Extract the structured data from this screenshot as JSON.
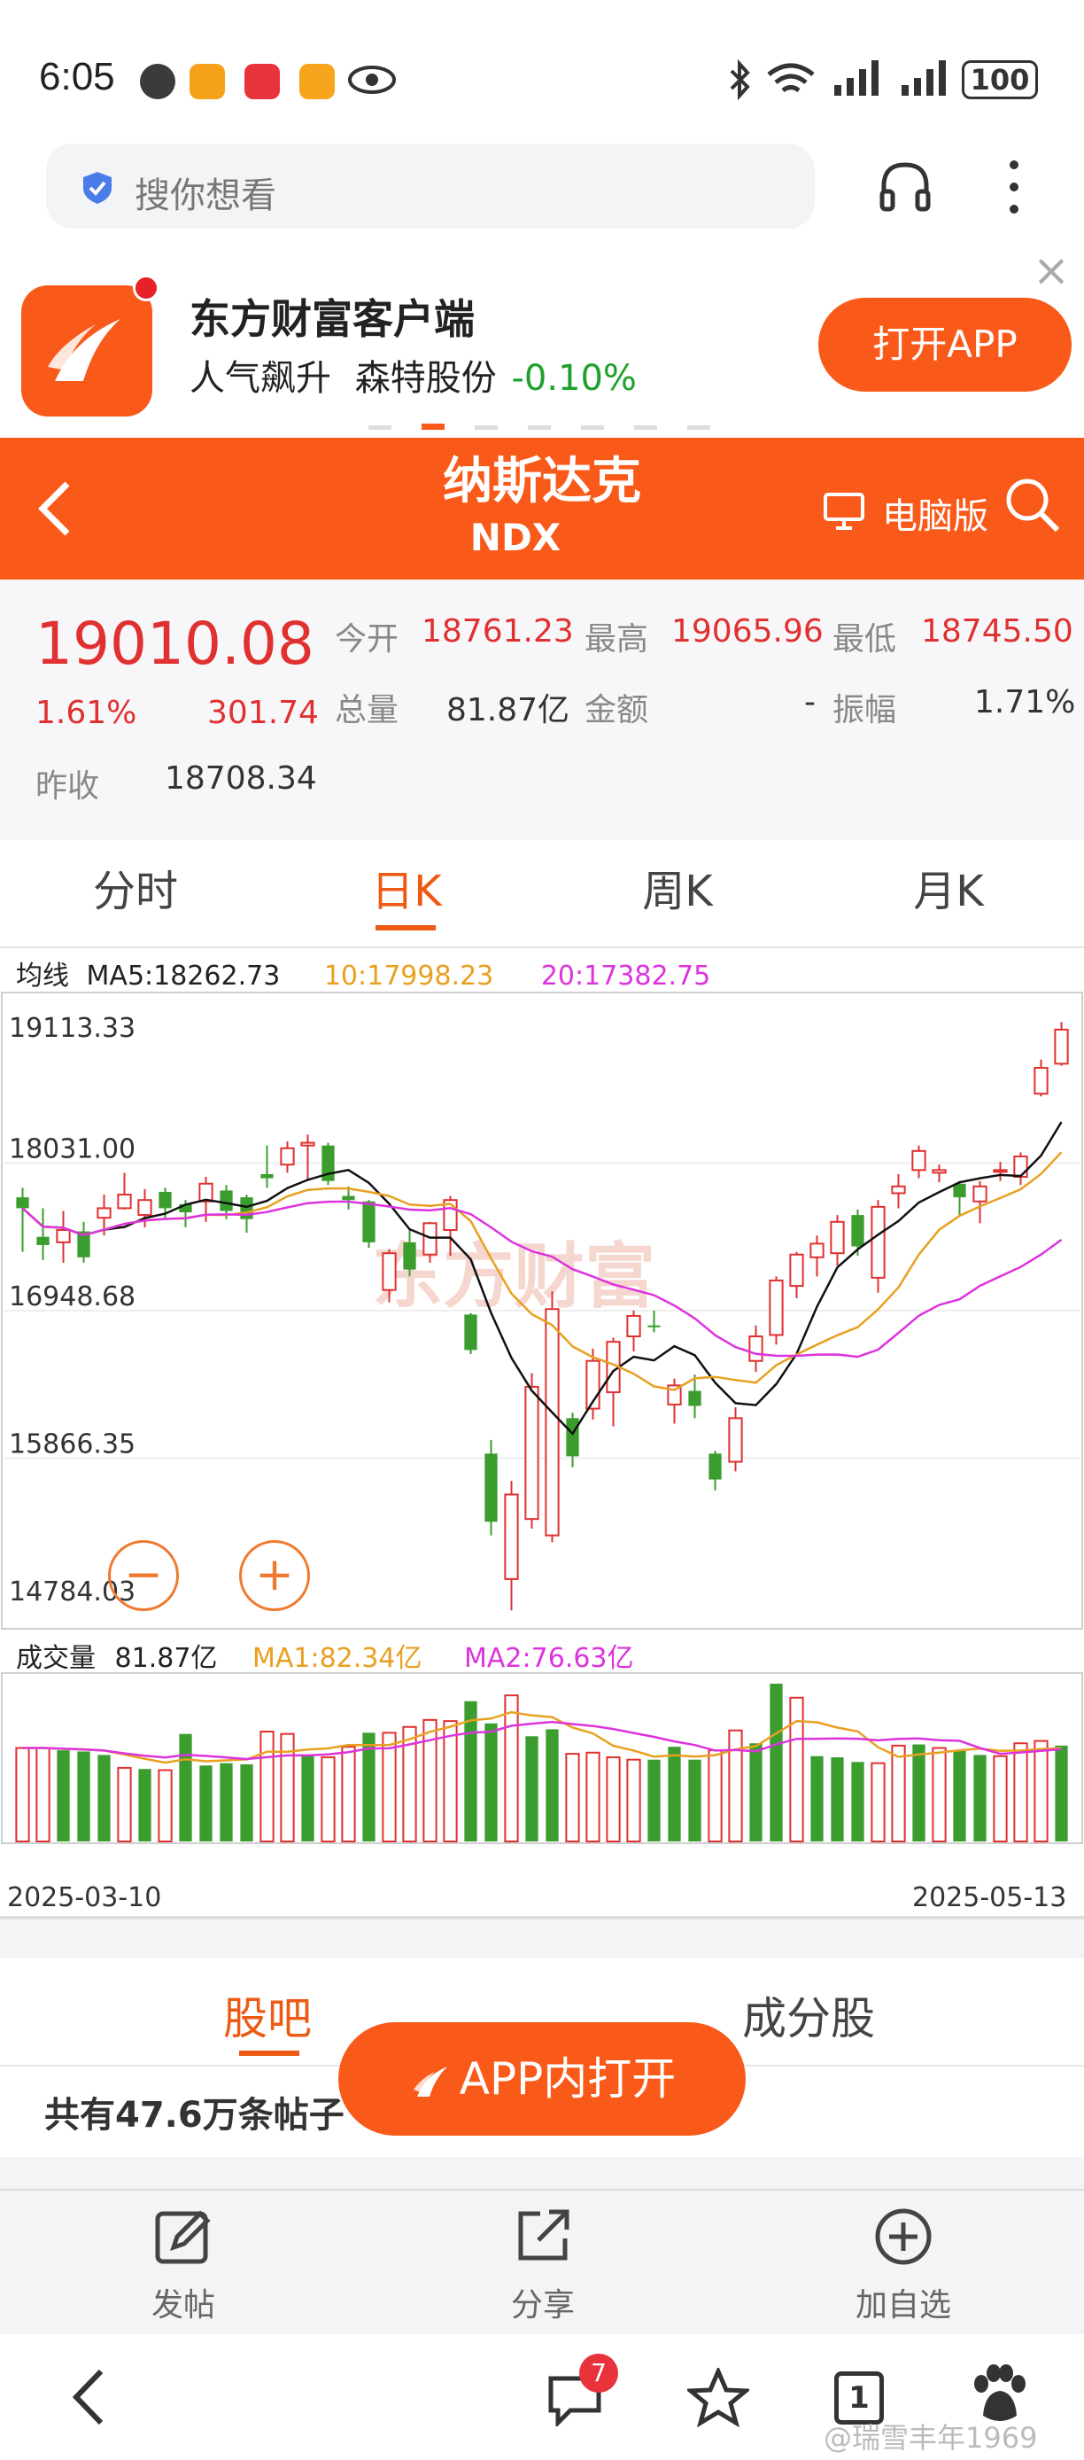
{
  "status_bar": {
    "time": "6:05",
    "battery": "100"
  },
  "search": {
    "placeholder": "搜你想看"
  },
  "ad_banner": {
    "title": "东方财富客户端",
    "subtitle_prefix": "人气飙升",
    "stock_name": "森特股份",
    "stock_change": "-0.10%",
    "button": "打开APP",
    "close": "×"
  },
  "header": {
    "title": "纳斯达克",
    "code": "NDX",
    "desktop_label": "电脑版"
  },
  "quote": {
    "price": "19010.08",
    "change_pct": "1.61%",
    "change_abs": "301.74",
    "prev_close_label": "昨收",
    "prev_close": "18708.34",
    "open_label": "今开",
    "open": "18761.23",
    "high_label": "最高",
    "high": "19065.96",
    "low_label": "最低",
    "low": "18745.50",
    "volume_label": "总量",
    "volume": "81.87亿",
    "amount_label": "金额",
    "amount": "-",
    "amplitude_label": "振幅",
    "amplitude": "1.71%"
  },
  "tabs": [
    "分时",
    "日K",
    "周K",
    "月K"
  ],
  "ma_legend": {
    "prefix": "均线",
    "ma5": "MA5:18262.73",
    "ma10": "10:17998.23",
    "ma20": "20:17382.75"
  },
  "vol_legend": {
    "prefix": "成交量",
    "value": "81.87亿",
    "ma1": "MA1:82.34亿",
    "ma2": "MA2:76.63亿"
  },
  "watermark": "东方财富",
  "zoom": {
    "minus": "−",
    "plus": "+"
  },
  "colors": {
    "up": "#e03030",
    "down": "#3a9d2e",
    "ma5": "#111111",
    "ma10": "#e8a020",
    "ma20": "#dd33dd",
    "accent": "#f95a19"
  },
  "chart_data": {
    "type": "candlestick",
    "x_start": "2025-03-10",
    "x_end": "2025-05-13",
    "price_ticks": [
      "19113.33",
      "18031.00",
      "16948.68",
      "15866.35",
      "14784.03"
    ],
    "ylim": [
      14784.03,
      19113.33
    ],
    "candles": [
      [
        17780,
        17700,
        17850,
        17380
      ],
      [
        17490,
        17430,
        17700,
        17320
      ],
      [
        17450,
        17540,
        17680,
        17300
      ],
      [
        17530,
        17340,
        17600,
        17300
      ],
      [
        17630,
        17700,
        17800,
        17500
      ],
      [
        17700,
        17800,
        17960,
        17690
      ],
      [
        17650,
        17760,
        17840,
        17560
      ],
      [
        17820,
        17700,
        17850,
        17620
      ],
      [
        17730,
        17670,
        17760,
        17560
      ],
      [
        17750,
        17880,
        17930,
        17600
      ],
      [
        17830,
        17680,
        17870,
        17620
      ],
      [
        17780,
        17620,
        17800,
        17520
      ],
      [
        17950,
        17920,
        18160,
        17850
      ],
      [
        18020,
        18140,
        18190,
        17960
      ],
      [
        18160,
        18180,
        18240,
        17900
      ],
      [
        18160,
        17900,
        18180,
        17870
      ],
      [
        17790,
        17760,
        17860,
        17690
      ],
      [
        17750,
        17450,
        17760,
        17410
      ],
      [
        17100,
        17370,
        17400,
        17010
      ],
      [
        17450,
        17250,
        17540,
        17200
      ],
      [
        17360,
        17590,
        17600,
        17300
      ],
      [
        17540,
        17760,
        17790,
        17350
      ],
      [
        16920,
        16660,
        16930,
        16630
      ],
      [
        15900,
        15400,
        16000,
        15300
      ],
      [
        14980,
        15600,
        15700,
        14750
      ],
      [
        15420,
        16390,
        16490,
        15350
      ],
      [
        15300,
        16960,
        17090,
        15250
      ],
      [
        16160,
        15880,
        16200,
        15800
      ],
      [
        16230,
        16580,
        16670,
        16150
      ],
      [
        16350,
        16720,
        16750,
        16100
      ],
      [
        16760,
        16910,
        16950,
        16650
      ],
      [
        16840,
        16830,
        16950,
        16790
      ],
      [
        16260,
        16400,
        16450,
        16120
      ],
      [
        16360,
        16250,
        16480,
        16160
      ],
      [
        15900,
        15710,
        15920,
        15630
      ],
      [
        15840,
        16160,
        16240,
        15770
      ],
      [
        16580,
        16760,
        16840,
        16500
      ],
      [
        16770,
        17170,
        17200,
        16700
      ],
      [
        17130,
        17360,
        17380,
        17040
      ],
      [
        17340,
        17440,
        17500,
        17200
      ],
      [
        17370,
        17600,
        17650,
        17280
      ],
      [
        17650,
        17420,
        17690,
        17350
      ],
      [
        17190,
        17710,
        17760,
        17080
      ],
      [
        17810,
        17860,
        17950,
        17700
      ],
      [
        17980,
        18120,
        18160,
        17920
      ],
      [
        17960,
        17980,
        18020,
        17890
      ],
      [
        17880,
        17780,
        17900,
        17650
      ],
      [
        17750,
        17860,
        17900,
        17590
      ],
      [
        17980,
        17980,
        18040,
        17900
      ],
      [
        17930,
        18080,
        18110,
        17870
      ],
      [
        18540,
        18730,
        18790,
        18520
      ],
      [
        18760,
        19010,
        19066,
        18745
      ]
    ],
    "volumes": [
      [
        8.0,
        0
      ],
      [
        8.0,
        0
      ],
      [
        7.8,
        1
      ],
      [
        7.7,
        1
      ],
      [
        7.4,
        1
      ],
      [
        6.3,
        0
      ],
      [
        6.2,
        1
      ],
      [
        6.1,
        0
      ],
      [
        9.2,
        1
      ],
      [
        6.5,
        1
      ],
      [
        6.7,
        1
      ],
      [
        6.6,
        1
      ],
      [
        9.4,
        0
      ],
      [
        9.2,
        0
      ],
      [
        7.4,
        1
      ],
      [
        7.2,
        0
      ],
      [
        8.1,
        0
      ],
      [
        9.3,
        1
      ],
      [
        9.3,
        0
      ],
      [
        9.8,
        0
      ],
      [
        10.4,
        0
      ],
      [
        10.3,
        0
      ],
      [
        12.0,
        1
      ],
      [
        10.1,
        1
      ],
      [
        12.5,
        0
      ],
      [
        9.0,
        1
      ],
      [
        9.6,
        1
      ],
      [
        7.5,
        0
      ],
      [
        7.6,
        0
      ],
      [
        7.2,
        0
      ],
      [
        7.0,
        0
      ],
      [
        7.0,
        1
      ],
      [
        8.1,
        1
      ],
      [
        7.0,
        1
      ],
      [
        7.8,
        0
      ],
      [
        9.5,
        0
      ],
      [
        8.4,
        1
      ],
      [
        13.5,
        1
      ],
      [
        12.3,
        0
      ],
      [
        7.3,
        1
      ],
      [
        7.2,
        1
      ],
      [
        6.8,
        1
      ],
      [
        6.7,
        0
      ],
      [
        8.2,
        0
      ],
      [
        8.3,
        1
      ],
      [
        8.0,
        0
      ],
      [
        7.8,
        1
      ],
      [
        7.4,
        1
      ],
      [
        7.3,
        0
      ],
      [
        8.4,
        0
      ],
      [
        8.6,
        0
      ],
      [
        8.2,
        1
      ]
    ],
    "vol_max": 13.8
  },
  "lower_tabs": [
    "股吧",
    "成分股"
  ],
  "post_count": "共有47.6万条帖子",
  "open_in_app": "APP内打开",
  "toolbar": {
    "post": "发帖",
    "share": "分享",
    "add_watch": "加自选"
  },
  "nav": {
    "comments_badge": "7",
    "tabs_count": "1"
  },
  "footer_watermark": "@瑞雪丰年1969"
}
